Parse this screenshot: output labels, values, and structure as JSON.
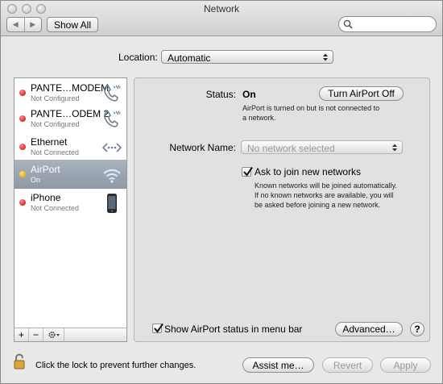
{
  "window": {
    "title": "Network"
  },
  "toolbar": {
    "show_all": "Show All"
  },
  "location": {
    "label": "Location:",
    "value": "Automatic"
  },
  "services": [
    {
      "name": "PANTE…MODEM",
      "status": "Not Configured",
      "indicator": "red",
      "icon": "phone-modem-icon"
    },
    {
      "name": "PANTE…ODEM 2",
      "status": "Not Configured",
      "indicator": "red",
      "icon": "phone-modem-icon"
    },
    {
      "name": "Ethernet",
      "status": "Not Connected",
      "indicator": "red",
      "icon": "ethernet-icon"
    },
    {
      "name": "AirPort",
      "status": "On",
      "indicator": "yellow",
      "icon": "airport-wifi-icon",
      "selected": true
    },
    {
      "name": "iPhone",
      "status": "Not Connected",
      "indicator": "red",
      "icon": "iphone-icon"
    }
  ],
  "detail": {
    "status_label": "Status:",
    "status_value": "On",
    "turn_off_button": "Turn AirPort Off",
    "status_desc_1": "AirPort is turned on but is not connected to",
    "status_desc_2": "a network.",
    "network_name_label": "Network Name:",
    "network_name_value": "No network selected",
    "ask_join_label": "Ask to join new networks",
    "ask_join_checked": true,
    "ask_desc_1": "Known networks will be joined automatically.",
    "ask_desc_2": "If no known networks are available, you will",
    "ask_desc_3": "be asked before joining a new network.",
    "show_status_label": "Show AirPort status in menu bar",
    "show_status_checked": true,
    "advanced_button": "Advanced…",
    "help_label": "?"
  },
  "footer": {
    "lock_text": "Click the lock to prevent further changes.",
    "assist_button": "Assist me…",
    "revert_button": "Revert",
    "apply_button": "Apply"
  },
  "colors": {
    "selection": "#9aa3b0",
    "status_red": "#c3080c",
    "status_yellow": "#e49a00"
  }
}
